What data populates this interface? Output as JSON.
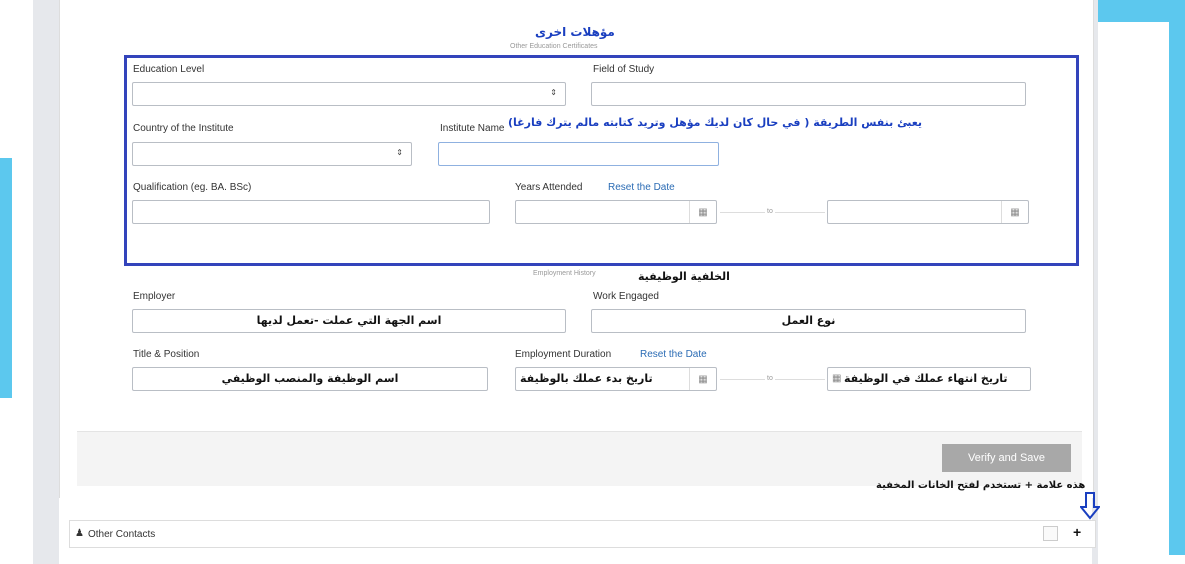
{
  "header": {
    "other_quals_ar": "مؤهلات اخرى",
    "other_certs_en": "Other Education Certificates"
  },
  "education": {
    "education_level_label": "Education Level",
    "field_of_study_label": "Field of Study",
    "country_label": "Country of the Institute",
    "institute_name_label": "Institute Name",
    "institute_note_ar": "يعبئ بنفس الطريقة ( في حال كان لديك مؤهل وتريد كتابته مالم يترك فارغا)",
    "qualification_label": "Qualification (eg. BA. BSc)",
    "years_attended_label": "Years Attended",
    "reset_date": "Reset the Date",
    "to": "to"
  },
  "employment": {
    "section_en": "Employment History",
    "section_ar": "الخلفية الوظيفية",
    "employer_label": "Employer",
    "employer_value": "اسم الجهة التي عملت -تعمل لديها",
    "work_engaged_label": "Work Engaged",
    "work_engaged_value": "نوع العمل",
    "title_label": "Title & Position",
    "title_value": "اسم الوظيفة والمنصب الوظيفي",
    "duration_label": "Employment Duration",
    "reset_date": "Reset the Date",
    "start_value": "تاريخ بدء عملك بالوظيفة",
    "to": "to",
    "end_value": "تاريخ انتهاء عملك في الوظيفة"
  },
  "footer": {
    "verify_save": "Verify and Save",
    "plus_note_ar": "هذه علامة + تستخدم لفتح الخانات المخفية"
  },
  "contacts": {
    "label": "Other Contacts",
    "plus": "+"
  },
  "icons": {
    "calendar": "calendar-icon",
    "select_arrow": "sort-arrows-icon",
    "user": "user-icon",
    "arrow_down": "arrow-down-icon"
  },
  "colors": {
    "cyan": "#5cc8ee",
    "box_border": "#3344bb",
    "link": "#2a6bb4",
    "button": "#a8a8a8"
  }
}
